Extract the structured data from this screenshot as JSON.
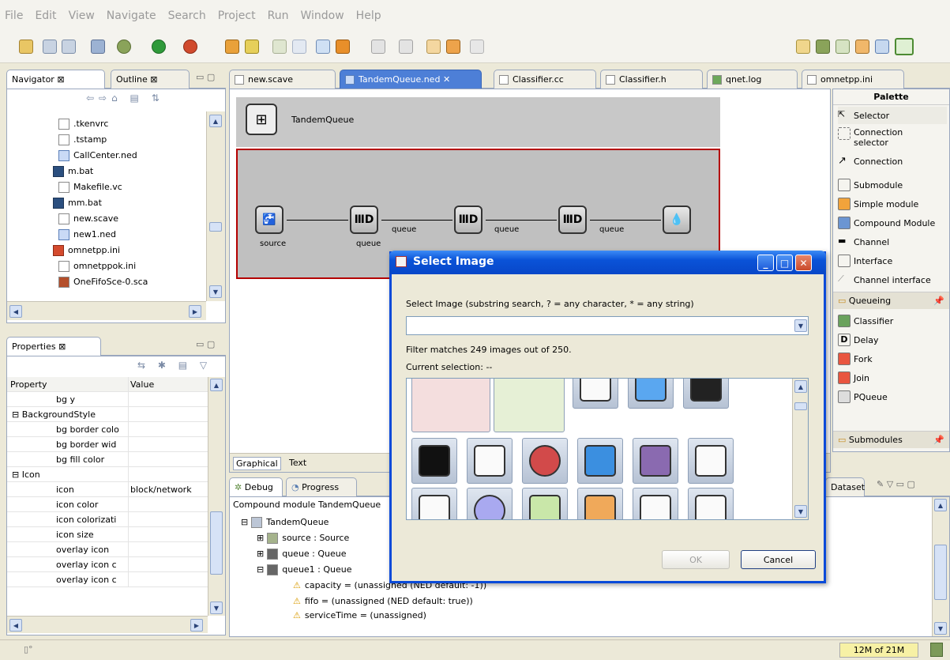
{
  "menu": [
    "File",
    "Edit",
    "View",
    "Navigate",
    "Search",
    "Project",
    "Run",
    "Window",
    "Help"
  ],
  "navigator": {
    "tab_label": "Navigator",
    "tab2_label": "Outline",
    "files": [
      ".tkenvrc",
      ".tstamp",
      "CallCenter.ned",
      "m.bat",
      "Makefile.vc",
      "mm.bat",
      "new.scave",
      "new1.ned",
      "omnetpp.ini",
      "omnetppok.ini",
      "OneFifoSce-0.sca"
    ]
  },
  "properties": {
    "tab_label": "Properties",
    "col_property": "Property",
    "col_value": "Value",
    "rows": [
      {
        "k": "bg y",
        "v": ""
      },
      {
        "k": "BackgroundStyle",
        "v": ""
      },
      {
        "k": "bg border colo",
        "v": ""
      },
      {
        "k": "bg border wid",
        "v": ""
      },
      {
        "k": "bg fill color",
        "v": ""
      },
      {
        "k": "Icon",
        "v": ""
      },
      {
        "k": "icon",
        "v": "block/network"
      },
      {
        "k": "icon color",
        "v": ""
      },
      {
        "k": "icon colorizati",
        "v": ""
      },
      {
        "k": "icon size",
        "v": ""
      },
      {
        "k": "overlay icon",
        "v": ""
      },
      {
        "k": "overlay icon c",
        "v": ""
      },
      {
        "k": "overlay icon c",
        "v": ""
      }
    ]
  },
  "editor_tabs": [
    "new.scave",
    "TandemQueue.ned",
    "Classifier.cc",
    "Classifier.h",
    "qnet.log",
    "omnetpp.ini"
  ],
  "canvas": {
    "module_title": "TandemQueue",
    "nodes": [
      "source",
      "queue",
      "queue",
      "queue",
      ""
    ],
    "bottom_tabs": [
      "Graphical",
      "Text"
    ]
  },
  "palette": {
    "title": "Palette",
    "items": [
      "Selector",
      "Connection selector",
      "Connection",
      "Submodule",
      "Simple module",
      "Compound Module",
      "Channel",
      "Interface",
      "Channel interface"
    ],
    "section_queueing": "Queueing",
    "queueing_items": [
      "Classifier",
      "Delay",
      "Fork",
      "Join",
      "PQueue"
    ],
    "section_submodules": "Submodules"
  },
  "debug": {
    "tab1": "Debug",
    "tab2": "Progress",
    "tab3": "Dataset",
    "header": "Compound module TandemQueue",
    "tree": [
      "TandemQueue",
      "source : Source",
      "queue : Queue",
      "queue1 : Queue",
      "capacity = (unassigned (NED default: -1))",
      "fifo = (unassigned (NED default: true))",
      "serviceTime = (unassigned)"
    ]
  },
  "dialog": {
    "title": "Select Image",
    "prompt": "Select Image (substring search, ? = any character, * = any string)",
    "input_value": "",
    "filter_text": "Filter matches 249 images out of 250.",
    "current_selection": "Current selection: --",
    "ok_label": "OK",
    "cancel_label": "Cancel"
  },
  "status": {
    "memory": "12M of 21M"
  }
}
